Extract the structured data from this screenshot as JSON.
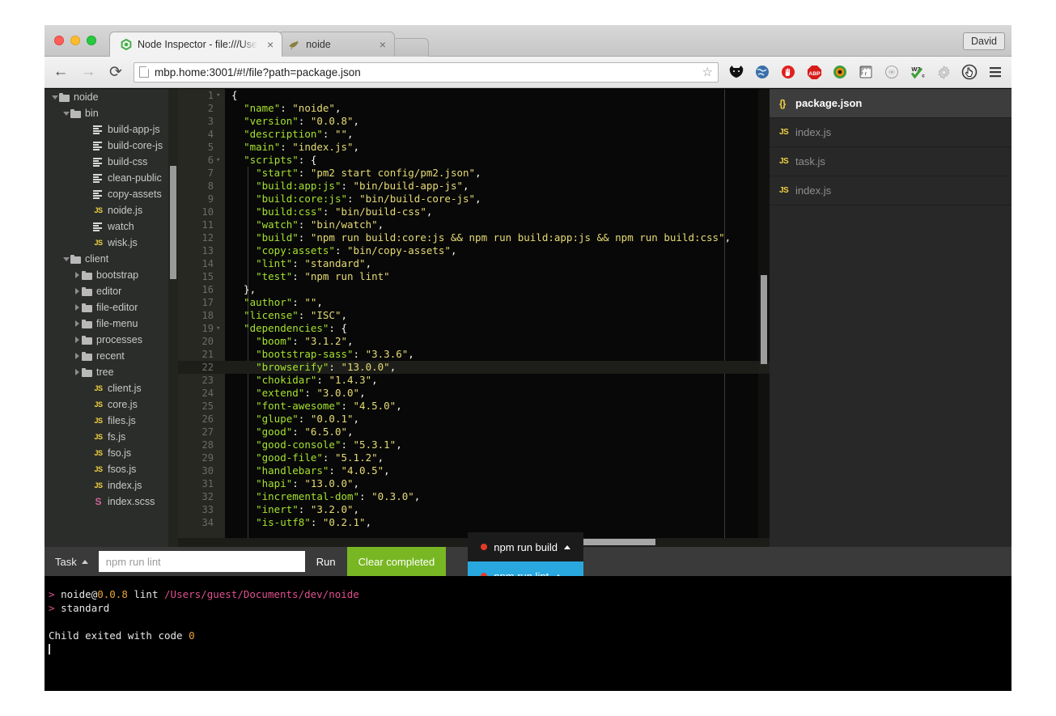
{
  "window": {
    "user_chip_label": "David",
    "traffic_lights": [
      "close",
      "minimize",
      "zoom"
    ]
  },
  "tabs": [
    {
      "title": "Node Inspector - file:///Use",
      "icon": "nodejs-icon",
      "active": true,
      "close_label": "×"
    },
    {
      "title": "noide",
      "icon": "noide-icon",
      "active": false,
      "close_label": "×"
    }
  ],
  "toolbar": {
    "back_label": "←",
    "forward_label": "→",
    "reload_label": "⟳",
    "url": "mbp.home:3001/#!/file?path=package.json",
    "star_label": "☆",
    "extensions": [
      "catblock-icon",
      "globe-icon",
      "stop-hand-icon",
      "adblock-plus-icon",
      "avocode-icon",
      "ruler-icon",
      "dotted-circle-icon",
      "w3c-validator-icon",
      "gear-icon",
      "click-pointer-icon"
    ],
    "menu_label": "☰"
  },
  "sidebar": {
    "items": [
      {
        "label": "noide",
        "indent": 0,
        "type": "folder",
        "caret": "down"
      },
      {
        "label": "bin",
        "indent": 1,
        "type": "folder",
        "caret": "down"
      },
      {
        "label": "build-app-js",
        "indent": 3,
        "type": "shell",
        "caret": "none"
      },
      {
        "label": "build-core-js",
        "indent": 3,
        "type": "shell",
        "caret": "none"
      },
      {
        "label": "build-css",
        "indent": 3,
        "type": "shell",
        "caret": "none"
      },
      {
        "label": "clean-public",
        "indent": 3,
        "type": "shell",
        "caret": "none"
      },
      {
        "label": "copy-assets",
        "indent": 3,
        "type": "shell",
        "caret": "none"
      },
      {
        "label": "noide.js",
        "indent": 3,
        "type": "js",
        "caret": "none"
      },
      {
        "label": "watch",
        "indent": 3,
        "type": "shell",
        "caret": "none"
      },
      {
        "label": "wisk.js",
        "indent": 3,
        "type": "js",
        "caret": "none"
      },
      {
        "label": "client",
        "indent": 1,
        "type": "folder",
        "caret": "down"
      },
      {
        "label": "bootstrap",
        "indent": 2,
        "type": "folder",
        "caret": "right"
      },
      {
        "label": "editor",
        "indent": 2,
        "type": "folder",
        "caret": "right"
      },
      {
        "label": "file-editor",
        "indent": 2,
        "type": "folder",
        "caret": "right"
      },
      {
        "label": "file-menu",
        "indent": 2,
        "type": "folder",
        "caret": "right"
      },
      {
        "label": "processes",
        "indent": 2,
        "type": "folder",
        "caret": "right"
      },
      {
        "label": "recent",
        "indent": 2,
        "type": "folder",
        "caret": "right"
      },
      {
        "label": "tree",
        "indent": 2,
        "type": "folder",
        "caret": "right"
      },
      {
        "label": "client.js",
        "indent": 3,
        "type": "js",
        "caret": "none"
      },
      {
        "label": "core.js",
        "indent": 3,
        "type": "js",
        "caret": "none"
      },
      {
        "label": "files.js",
        "indent": 3,
        "type": "js",
        "caret": "none"
      },
      {
        "label": "fs.js",
        "indent": 3,
        "type": "js",
        "caret": "none"
      },
      {
        "label": "fso.js",
        "indent": 3,
        "type": "js",
        "caret": "none"
      },
      {
        "label": "fsos.js",
        "indent": 3,
        "type": "js",
        "caret": "none"
      },
      {
        "label": "index.js",
        "indent": 3,
        "type": "js",
        "caret": "none"
      },
      {
        "label": "index.scss",
        "indent": 3,
        "type": "scss",
        "caret": "none"
      }
    ]
  },
  "editor": {
    "filename": "package.json",
    "highlighted_line": 22,
    "lines": [
      {
        "n": 1,
        "fold": "▾",
        "text": "{"
      },
      {
        "n": 2,
        "fold": "",
        "text": "  \"name\": \"noide\","
      },
      {
        "n": 3,
        "fold": "",
        "text": "  \"version\": \"0.0.8\","
      },
      {
        "n": 4,
        "fold": "",
        "text": "  \"description\": \"\","
      },
      {
        "n": 5,
        "fold": "",
        "text": "  \"main\": \"index.js\","
      },
      {
        "n": 6,
        "fold": "▾",
        "text": "  \"scripts\": {"
      },
      {
        "n": 7,
        "fold": "",
        "text": "    \"start\": \"pm2 start config/pm2.json\","
      },
      {
        "n": 8,
        "fold": "",
        "text": "    \"build:app:js\": \"bin/build-app-js\","
      },
      {
        "n": 9,
        "fold": "",
        "text": "    \"build:core:js\": \"bin/build-core-js\","
      },
      {
        "n": 10,
        "fold": "",
        "text": "    \"build:css\": \"bin/build-css\","
      },
      {
        "n": 11,
        "fold": "",
        "text": "    \"watch\": \"bin/watch\","
      },
      {
        "n": 12,
        "fold": "",
        "text": "    \"build\": \"npm run build:core:js && npm run build:app:js && npm run build:css\","
      },
      {
        "n": 13,
        "fold": "",
        "text": "    \"copy:assets\": \"bin/copy-assets\","
      },
      {
        "n": 14,
        "fold": "",
        "text": "    \"lint\": \"standard\","
      },
      {
        "n": 15,
        "fold": "",
        "text": "    \"test\": \"npm run lint\""
      },
      {
        "n": 16,
        "fold": "",
        "text": "  },"
      },
      {
        "n": 17,
        "fold": "",
        "text": "  \"author\": \"\","
      },
      {
        "n": 18,
        "fold": "",
        "text": "  \"license\": \"ISC\","
      },
      {
        "n": 19,
        "fold": "▾",
        "text": "  \"dependencies\": {"
      },
      {
        "n": 20,
        "fold": "",
        "text": "    \"boom\": \"3.1.2\","
      },
      {
        "n": 21,
        "fold": "",
        "text": "    \"bootstrap-sass\": \"3.3.6\","
      },
      {
        "n": 22,
        "fold": "",
        "text": "    \"browserify\": \"13.0.0\","
      },
      {
        "n": 23,
        "fold": "",
        "text": "    \"chokidar\": \"1.4.3\","
      },
      {
        "n": 24,
        "fold": "",
        "text": "    \"extend\": \"3.0.0\","
      },
      {
        "n": 25,
        "fold": "",
        "text": "    \"font-awesome\": \"4.5.0\","
      },
      {
        "n": 26,
        "fold": "",
        "text": "    \"glupe\": \"0.0.1\","
      },
      {
        "n": 27,
        "fold": "",
        "text": "    \"good\": \"6.5.0\","
      },
      {
        "n": 28,
        "fold": "",
        "text": "    \"good-console\": \"5.3.1\","
      },
      {
        "n": 29,
        "fold": "",
        "text": "    \"good-file\": \"5.1.2\","
      },
      {
        "n": 30,
        "fold": "",
        "text": "    \"handlebars\": \"4.0.5\","
      },
      {
        "n": 31,
        "fold": "",
        "text": "    \"hapi\": \"13.0.0\","
      },
      {
        "n": 32,
        "fold": "",
        "text": "    \"incremental-dom\": \"0.3.0\","
      },
      {
        "n": 33,
        "fold": "",
        "text": "    \"inert\": \"3.2.0\","
      },
      {
        "n": 34,
        "fold": "",
        "text": "    \"is-utf8\": \"0.2.1\","
      }
    ]
  },
  "open_files": {
    "items": [
      {
        "label": "package.json",
        "icon": "json-icon",
        "active": true
      },
      {
        "label": "index.js",
        "icon": "js-icon",
        "active": false
      },
      {
        "label": "task.js",
        "icon": "js-icon",
        "active": false
      },
      {
        "label": "index.js",
        "icon": "js-icon",
        "active": false
      }
    ]
  },
  "taskbar": {
    "menu_label": "Task",
    "input_value": "npm run lint",
    "input_placeholder": "npm run lint",
    "run_label": "Run",
    "clear_label": "Clear completed",
    "processes": [
      {
        "label": "npm run build",
        "selected": false,
        "status_color": "#e33b26"
      },
      {
        "label": "npm run lint",
        "selected": true,
        "status_color": "#e33b26"
      }
    ],
    "selected_color": "#29a8df",
    "clear_color": "#78b723"
  },
  "terminal": {
    "lines": [
      {
        "segments": [
          {
            "t": "> ",
            "c": "prompt"
          },
          {
            "t": "noide@",
            "c": "plain"
          },
          {
            "t": "0.0.8",
            "c": "ver"
          },
          {
            "t": " lint ",
            "c": "plain"
          },
          {
            "t": "/Users/guest/Documents/dev/noide",
            "c": "path"
          }
        ]
      },
      {
        "segments": [
          {
            "t": "> ",
            "c": "prompt"
          },
          {
            "t": "standard",
            "c": "plain"
          }
        ]
      },
      {
        "segments": []
      },
      {
        "segments": [
          {
            "t": "Child exited with code ",
            "c": "plain"
          },
          {
            "t": "0",
            "c": "code"
          }
        ]
      },
      {
        "segments": [
          {
            "t": "█",
            "c": "cursor"
          }
        ]
      }
    ]
  }
}
